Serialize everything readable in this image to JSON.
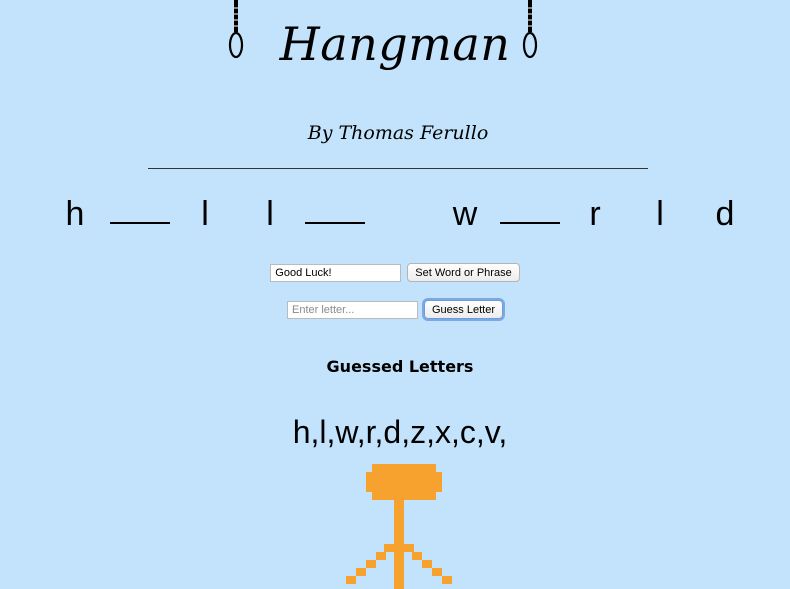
{
  "header": {
    "title": "Hangman",
    "byline": "By Thomas Ferullo"
  },
  "word": {
    "slots": [
      "h",
      "_",
      "l",
      "l",
      "_",
      " ",
      "w",
      "_",
      "r",
      "l",
      "d"
    ]
  },
  "controls": {
    "phrase_value": "Good Luck!",
    "set_button": "Set Word or Phrase",
    "letter_placeholder": "Enter letter...",
    "guess_button": "Guess Letter"
  },
  "guessed": {
    "heading": "Guessed Letters",
    "letters": "h,l,w,r,d,z,x,c,v,"
  },
  "colors": {
    "background": "#c2e3fb",
    "figure": "#f7a22f"
  }
}
